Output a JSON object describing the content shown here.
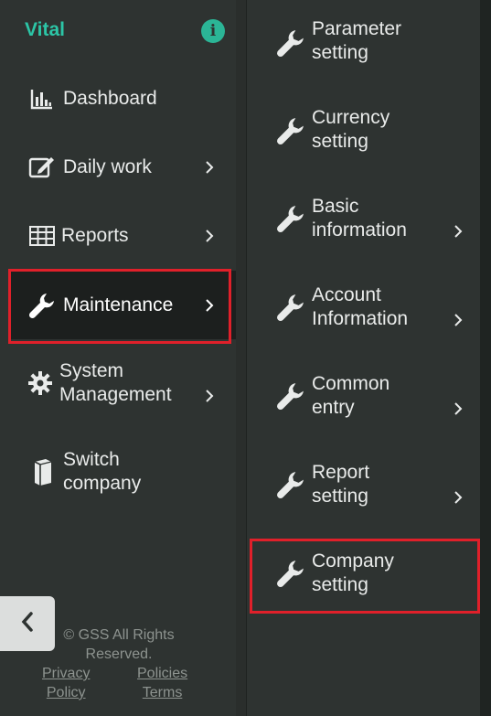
{
  "brand": "Vital",
  "info_icon_glyph": "i",
  "sidebar": {
    "items": [
      {
        "label": "Dashboard",
        "icon": "bar-chart-icon",
        "has_arrow": false
      },
      {
        "label": "Daily work",
        "icon": "edit-icon",
        "has_arrow": true
      },
      {
        "label": "Reports",
        "icon": "table-icon",
        "has_arrow": true
      },
      {
        "label": "Maintenance",
        "icon": "wrench-icon",
        "has_arrow": true,
        "active": true
      },
      {
        "label_line1": "System",
        "label_line2": "Management",
        "icon": "gear-icon",
        "has_arrow": true
      },
      {
        "label_line1": "Switch",
        "label_line2": "company",
        "icon": "book-icon",
        "has_arrow": false
      }
    ]
  },
  "footer": {
    "copyright_line1": "© GSS All Rights",
    "copyright_line2": "Reserved.",
    "privacy_line1": "Privacy",
    "privacy_line2": "Policy",
    "terms_line1": "Policies",
    "terms_line2": "Terms"
  },
  "submenu": {
    "items": [
      {
        "line1": "Parameter",
        "line2": "setting",
        "has_arrow": false
      },
      {
        "line1": "Currency",
        "line2": "setting",
        "has_arrow": false
      },
      {
        "line1": "Basic",
        "line2": "information",
        "has_arrow": true
      },
      {
        "line1": "Account",
        "line2": "Information",
        "has_arrow": true
      },
      {
        "line1": "Common",
        "line2": "entry",
        "has_arrow": true
      },
      {
        "line1": "Report",
        "line2": "setting",
        "has_arrow": true
      },
      {
        "line1": "Company",
        "line2": "setting",
        "has_arrow": false,
        "highlighted": true
      }
    ]
  },
  "colors": {
    "background": "#2e3331",
    "active_background": "#1c1f1e",
    "brand": "#2cc5a6",
    "highlight": "#e0202a"
  }
}
